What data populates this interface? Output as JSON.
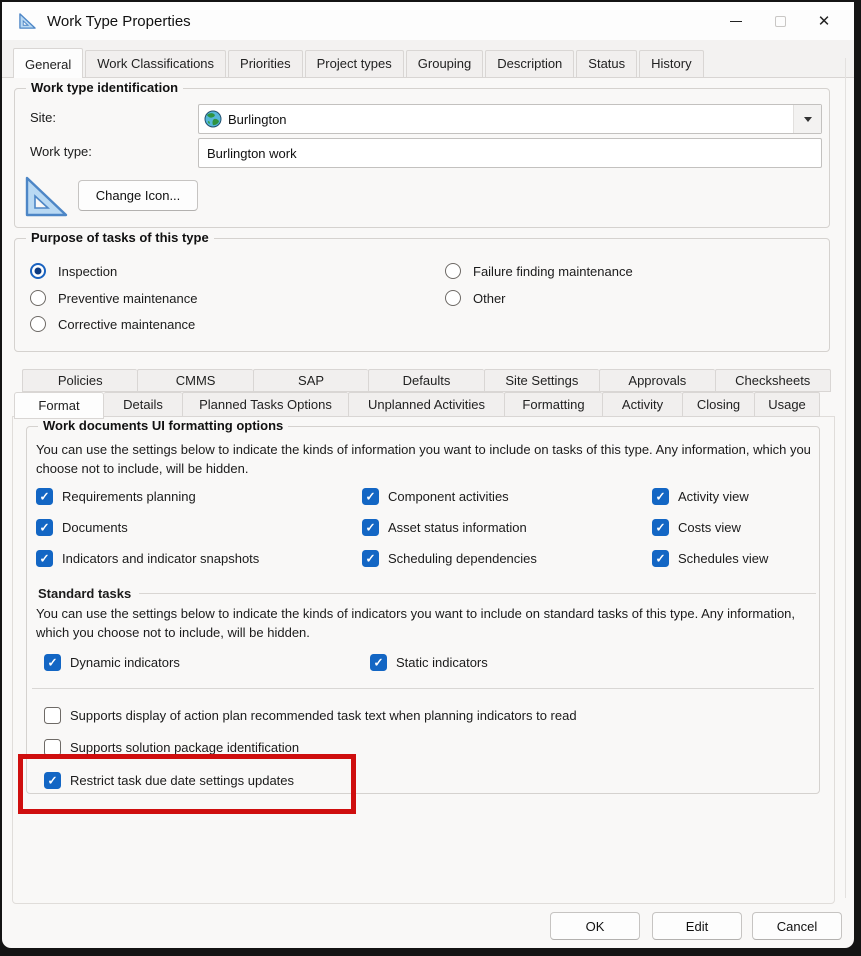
{
  "window": {
    "title": "Work Type Properties",
    "icon": "set-square-icon",
    "controls": [
      "minimize",
      "maximize",
      "close"
    ]
  },
  "top_tabs": [
    {
      "label": "General",
      "active": true
    },
    {
      "label": "Work Classifications",
      "active": false
    },
    {
      "label": "Priorities",
      "active": false
    },
    {
      "label": "Project types",
      "active": false
    },
    {
      "label": "Grouping",
      "active": false
    },
    {
      "label": "Description",
      "active": false
    },
    {
      "label": "Status",
      "active": false
    },
    {
      "label": "History",
      "active": false
    }
  ],
  "identification": {
    "group_title": "Work type identification",
    "site_label": "Site:",
    "site_value": "Burlington",
    "site_icon": "globe-icon",
    "work_type_label": "Work type:",
    "work_type_value": "Burlington work",
    "type_icon": "set-square-icon",
    "change_icon_button": "Change Icon..."
  },
  "purpose": {
    "group_title": "Purpose of tasks of this type",
    "options": [
      {
        "label": "Inspection",
        "selected": true
      },
      {
        "label": "Preventive maintenance",
        "selected": false
      },
      {
        "label": "Corrective maintenance",
        "selected": false
      },
      {
        "label": "Failure finding maintenance",
        "selected": false
      },
      {
        "label": "Other",
        "selected": false
      }
    ]
  },
  "inner_tabs_row1": [
    "Policies",
    "CMMS",
    "SAP",
    "Defaults",
    "Site Settings",
    "Approvals",
    "Checksheets"
  ],
  "inner_tabs_row2": [
    {
      "label": "Format",
      "active": true
    },
    {
      "label": "Details",
      "active": false
    },
    {
      "label": "Planned Tasks Options",
      "active": false
    },
    {
      "label": "Unplanned Activities",
      "active": false
    },
    {
      "label": "Formatting",
      "active": false
    },
    {
      "label": "Activity",
      "active": false
    },
    {
      "label": "Closing",
      "active": false
    },
    {
      "label": "Usage",
      "active": false
    }
  ],
  "format_tab": {
    "ui_options": {
      "group_title": "Work documents UI formatting options",
      "description": "You can use the settings below to indicate the kinds of information you want to include on tasks of this type.  Any information, which you choose not to include, will be hidden.",
      "checkboxes": [
        {
          "label": "Requirements planning",
          "checked": true
        },
        {
          "label": "Component activities",
          "checked": true
        },
        {
          "label": "Activity view",
          "checked": true
        },
        {
          "label": "Documents",
          "checked": true
        },
        {
          "label": "Asset status information",
          "checked": true
        },
        {
          "label": "Costs view",
          "checked": true
        },
        {
          "label": "Indicators and indicator snapshots",
          "checked": true
        },
        {
          "label": "Scheduling dependencies",
          "checked": true
        },
        {
          "label": "Schedules view",
          "checked": true
        }
      ]
    },
    "standard_tasks": {
      "section_title": "Standard tasks",
      "description": "You can use the settings below to indicate the kinds of indicators you want to include on standard tasks of this type.  Any information, which you choose not to include, will be hidden.",
      "checkboxes": [
        {
          "label": "Dynamic indicators",
          "checked": true
        },
        {
          "label": "Static indicators",
          "checked": true
        }
      ]
    },
    "extra_checkboxes": [
      {
        "label": "Supports display of action plan recommended task text when planning indicators to read",
        "checked": false
      },
      {
        "label": "Supports solution package identification",
        "checked": false
      },
      {
        "label": "Restrict task due date settings updates",
        "checked": true,
        "highlighted": true
      }
    ]
  },
  "footer_buttons": {
    "ok": "OK",
    "edit": "Edit",
    "cancel": "Cancel"
  },
  "colors": {
    "accent_blue": "#1366c4",
    "radio_blue": "#1a63c0",
    "highlight_red": "#cf0e0e",
    "dialog_bg": "#f9f8f7",
    "titlebar_bg": "#fdfdfd"
  }
}
